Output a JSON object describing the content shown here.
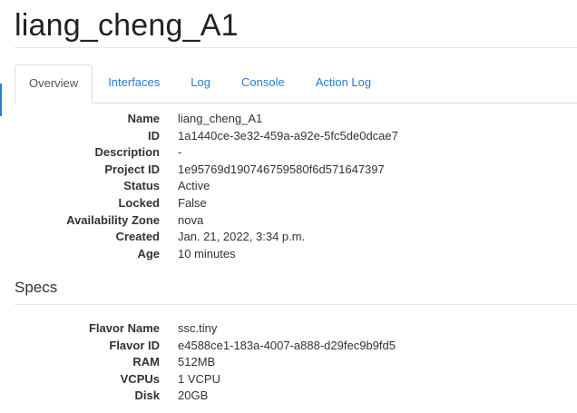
{
  "page": {
    "title": "liang_cheng_A1"
  },
  "tabs": [
    {
      "label": "Overview",
      "active": true
    },
    {
      "label": "Interfaces",
      "active": false
    },
    {
      "label": "Log",
      "active": false
    },
    {
      "label": "Console",
      "active": false
    },
    {
      "label": "Action Log",
      "active": false
    }
  ],
  "overview": [
    {
      "term": "Name",
      "value": "liang_cheng_A1"
    },
    {
      "term": "ID",
      "value": "1a1440ce-3e32-459a-a92e-5fc5de0dcae7"
    },
    {
      "term": "Description",
      "value": "-"
    },
    {
      "term": "Project ID",
      "value": "1e95769d190746759580f6d571647397"
    },
    {
      "term": "Status",
      "value": "Active"
    },
    {
      "term": "Locked",
      "value": "False"
    },
    {
      "term": "Availability Zone",
      "value": "nova"
    },
    {
      "term": "Created",
      "value": "Jan. 21, 2022, 3:34 p.m."
    },
    {
      "term": "Age",
      "value": "10 minutes"
    }
  ],
  "specs": {
    "title": "Specs",
    "items": [
      {
        "term": "Flavor Name",
        "value": "ssc.tiny"
      },
      {
        "term": "Flavor ID",
        "value": "e4588ce1-183a-4007-a888-d29fec9b9fd5"
      },
      {
        "term": "RAM",
        "value": "512MB"
      },
      {
        "term": "VCPUs",
        "value": "1 VCPU"
      },
      {
        "term": "Disk",
        "value": "20GB"
      }
    ]
  },
  "colors": {
    "link": "#2a7bd1",
    "text": "#333333",
    "border": "#dddddd"
  }
}
